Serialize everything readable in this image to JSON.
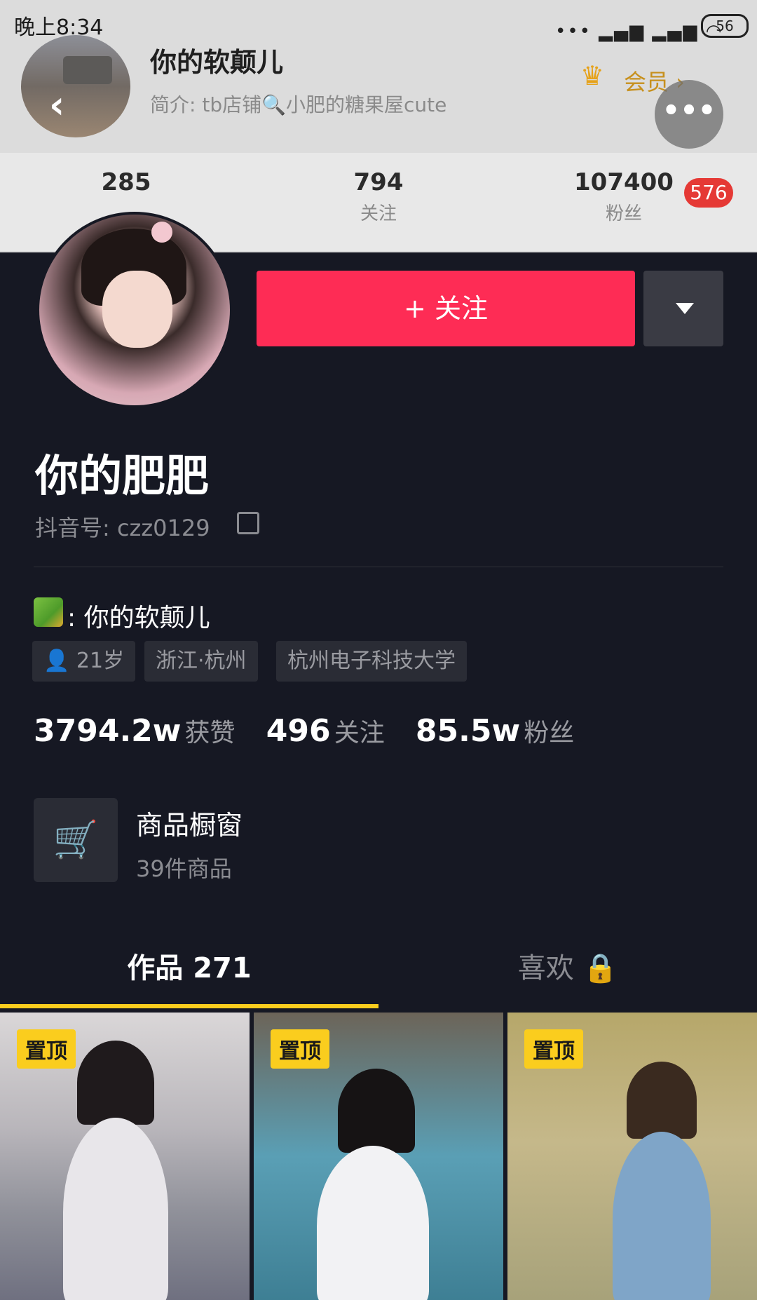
{
  "status_bar": {
    "time": "晚上8:34",
    "battery": "56"
  },
  "header": {
    "name": "你的软颠儿",
    "bio": "简介: tb店铺🔍小肥的糖果屋cute",
    "vip_label": "会员 ›",
    "stats": [
      {
        "value": "285",
        "label": ""
      },
      {
        "value": "794",
        "label": "关注"
      },
      {
        "value": "107400",
        "label": "粉丝"
      }
    ],
    "fans_badge": "576"
  },
  "profile": {
    "follow_label": "+ 关注",
    "display_name": "你的肥肥",
    "douyin_id": "抖音号: czz0129",
    "signature": ": 你的软颠儿",
    "tags": {
      "age": "21岁",
      "location": "浙江·杭州",
      "school": "杭州电子科技大学"
    },
    "counts": {
      "likes_value": "3794.2w",
      "likes_label": "获赞",
      "following_value": "496",
      "following_label": "关注",
      "fans_value": "85.5w",
      "fans_label": "粉丝"
    },
    "shop": {
      "title": "商品橱窗",
      "count": "39件商品"
    }
  },
  "tabs": {
    "works": "作品 271",
    "likes": "喜欢 🔒"
  },
  "thumbnails": [
    {
      "pin": "置顶"
    },
    {
      "pin": "置顶"
    },
    {
      "pin": "置顶"
    }
  ],
  "icons": {
    "back": "chevron-left-icon",
    "more": "more-dots-icon",
    "copy": "copy-icon",
    "cart": "cart-icon",
    "lock": "lock-icon"
  },
  "colors": {
    "accent": "#fe2c55",
    "tab_indicator": "#facd1e",
    "bg": "#161823"
  }
}
